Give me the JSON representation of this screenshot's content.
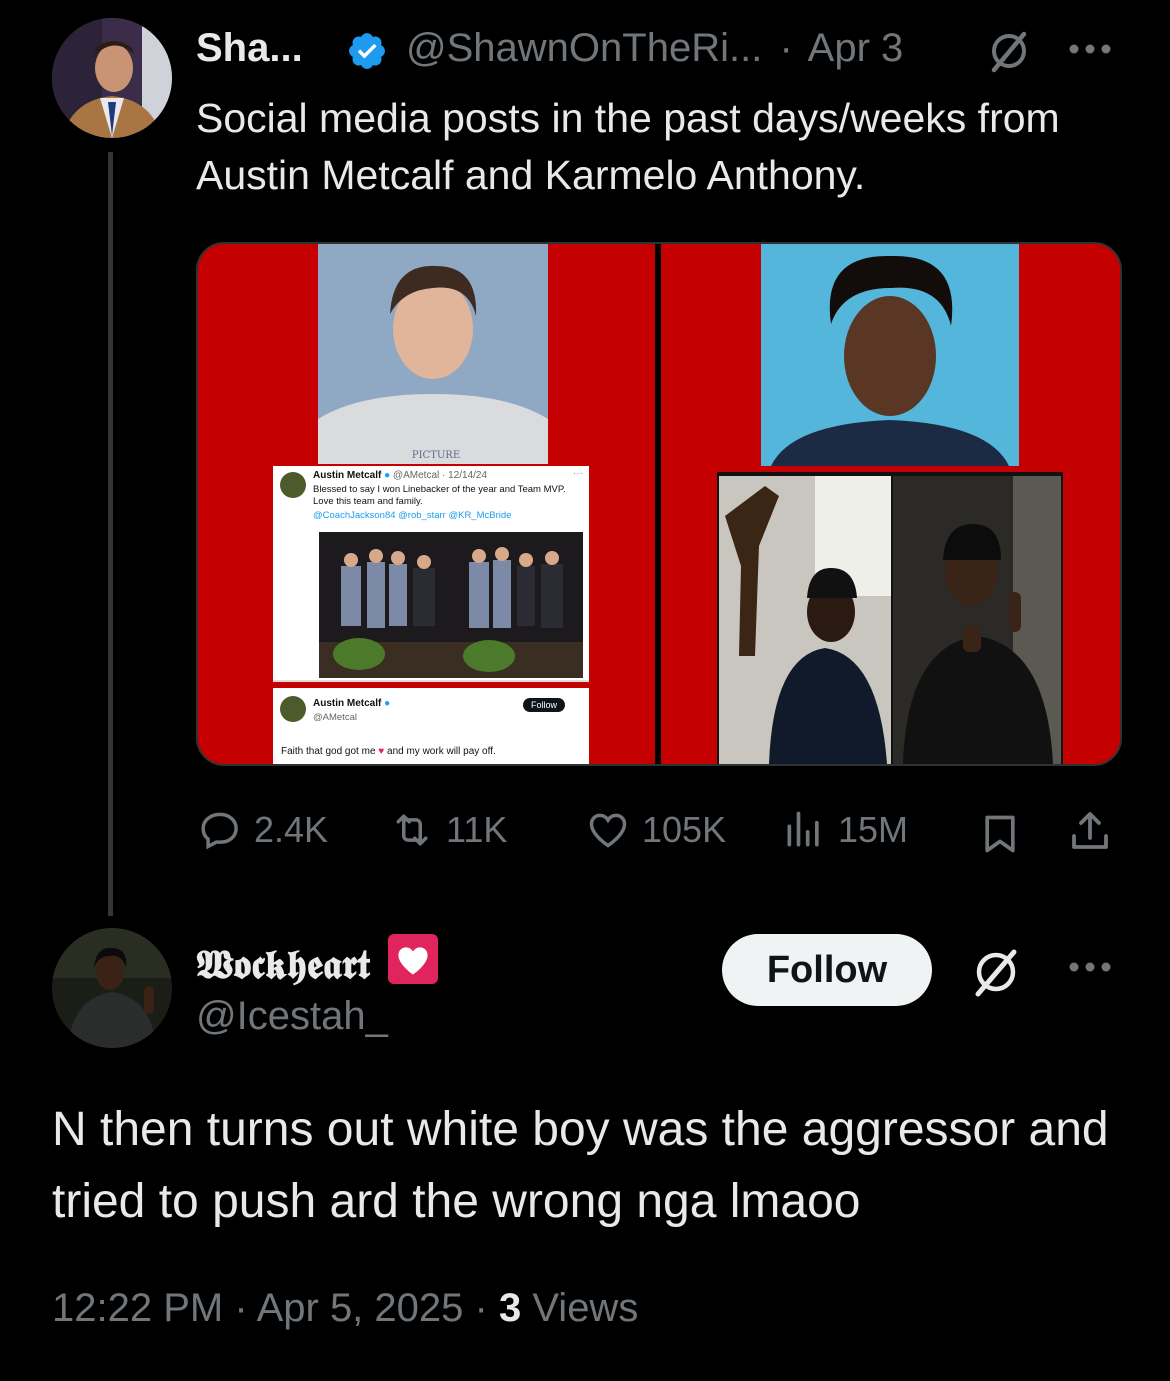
{
  "tweet": {
    "author_name": "Sha...",
    "handle": "@ShawnOnTheRi...",
    "separator": "·",
    "date": "Apr 3",
    "text": "Social media posts in the past days/weeks from Austin Metcalf and Karmelo Anthony.",
    "media": {
      "embedded_post_1": {
        "name": "Austin Metcalf",
        "handle_date": "@AMetcal · 12/14/24",
        "text": "Blessed to say I won Linebacker of the year and Team MVP. Love this team and family.",
        "mentions": "@CoachJackson84 @rob_starr @KR_McBride",
        "more": "···"
      },
      "embedded_post_2": {
        "name": "Austin Metcalf",
        "handle": "@AMetcal",
        "follow_label": "Follow",
        "text_before": "Faith that god got me",
        "text_after": "and my work will pay off."
      },
      "shirt_text": "PICTURE"
    },
    "stats": {
      "replies": "2.4K",
      "reposts": "11K",
      "likes": "105K",
      "views": "15M"
    }
  },
  "reply": {
    "author_name": "𝖂𝖔𝖈𝖐𝖍𝖊𝖆𝖗𝖙",
    "handle": "@Icestah_",
    "follow_label": "Follow",
    "text": "N then turns out white boy was the aggressor and tried to push ard the wrong nga lmaoo",
    "time": "12:22 PM",
    "date": "Apr 5, 2025",
    "views_count": "3",
    "views_label": "Views"
  },
  "colors": {
    "background": "#000000",
    "text": "#e7e9ea",
    "muted": "#71767b",
    "verified": "#1d9bf0",
    "media_red": "#c50000",
    "heart_red": "#e0245e"
  },
  "icons": [
    "verified-badge-icon",
    "grok-icon",
    "more-icon",
    "reply-icon",
    "repost-icon",
    "like-icon",
    "views-icon",
    "bookmark-icon",
    "share-icon",
    "heart-emoji-icon"
  ]
}
